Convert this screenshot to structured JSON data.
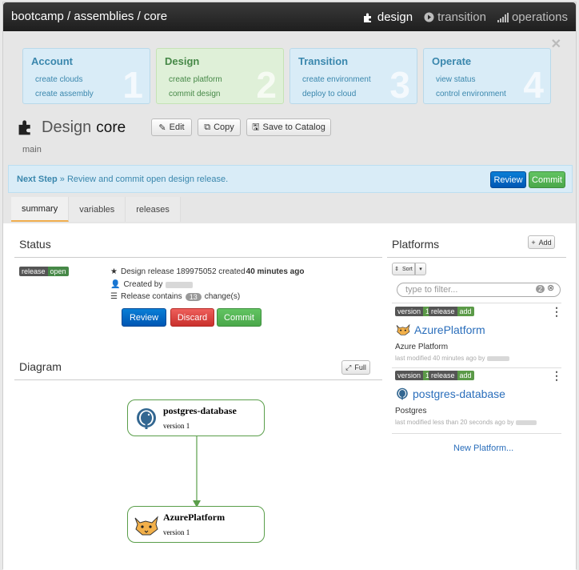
{
  "navbar": {
    "breadcrumb": "bootcamp / assemblies / core",
    "tabs": [
      {
        "label": "design",
        "icon": "puzzle-icon"
      },
      {
        "label": "transition",
        "icon": "play-icon"
      },
      {
        "label": "operations",
        "icon": "signal-icon"
      }
    ]
  },
  "steps": [
    {
      "title": "Account",
      "links": [
        "create clouds",
        "create assembly"
      ],
      "number": "1"
    },
    {
      "title": "Design",
      "links": [
        "create platform",
        "commit design"
      ],
      "number": "2"
    },
    {
      "title": "Transition",
      "links": [
        "create environment",
        "deploy to cloud"
      ],
      "number": "3"
    },
    {
      "title": "Operate",
      "links": [
        "view status",
        "control environment"
      ],
      "number": "4"
    }
  ],
  "header": {
    "title": "Design",
    "name": "core",
    "sub": "main",
    "buttons": {
      "edit": "Edit",
      "copy": "Copy",
      "save": "Save to Catalog"
    }
  },
  "next_step": {
    "label": "Next Step",
    "text": " » Review and commit open design release.",
    "review": "Review",
    "commit": "Commit"
  },
  "tabs": [
    "summary",
    "variables",
    "releases"
  ],
  "status": {
    "title": "Status",
    "label_release": "release",
    "label_open": "open",
    "line1_prefix": "Design release 189975052 created ",
    "line1_bold": "40 minutes ago",
    "created_by": "Created by",
    "contains_prefix": "Release contains",
    "contains_count": "13",
    "contains_suffix": "change(s)",
    "buttons": {
      "review": "Review",
      "discard": "Discard",
      "commit": "Commit"
    }
  },
  "diagram": {
    "title": "Diagram",
    "full": "Full",
    "nodes": [
      {
        "name": "postgres-database",
        "version": "version 1"
      },
      {
        "name": "AzurePlatform",
        "version": "version 1"
      }
    ]
  },
  "platforms": {
    "title": "Platforms",
    "add": "Add",
    "sort": "Sort",
    "filter_placeholder": "type to filter...",
    "filter_count": "2",
    "items": [
      {
        "version_label": "version",
        "version_num": "1",
        "release_label": "release",
        "release_state": "add",
        "name": "AzurePlatform",
        "desc": "Azure Platform",
        "meta": "last modified 40 minutes ago by"
      },
      {
        "version_label": "version",
        "version_num": "1",
        "release_label": "release",
        "release_state": "add",
        "name": "postgres-database",
        "desc": "Postgres",
        "meta": "last modified less than 20 seconds ago by"
      }
    ],
    "new_platform": "New Platform..."
  }
}
